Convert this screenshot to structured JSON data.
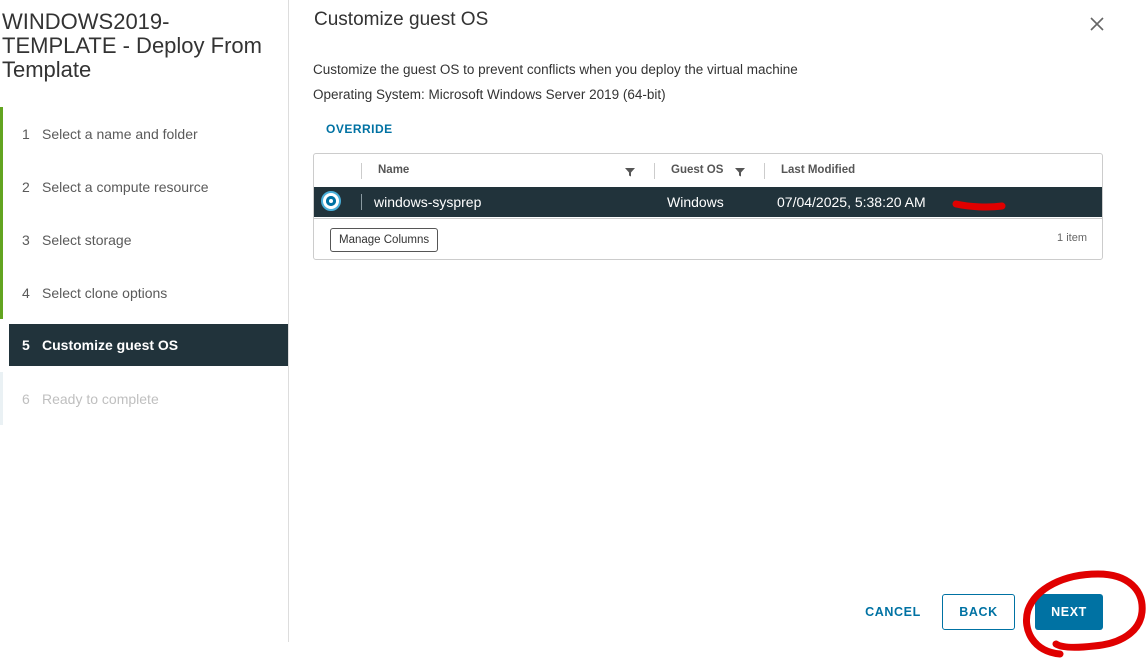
{
  "wizard": {
    "title": "WINDOWS2019-TEMPLATE - Deploy From Template",
    "steps": [
      {
        "num": "1",
        "label": "Select a name and folder"
      },
      {
        "num": "2",
        "label": "Select a compute resource"
      },
      {
        "num": "3",
        "label": "Select storage"
      },
      {
        "num": "4",
        "label": "Select clone options"
      },
      {
        "num": "5",
        "label": "Customize guest OS"
      },
      {
        "num": "6",
        "label": "Ready to complete"
      }
    ]
  },
  "main": {
    "title": "Customize guest OS",
    "description": "Customize the guest OS to prevent conflicts when you deploy the virtual machine",
    "os_line": "Operating System: Microsoft Windows Server 2019 (64-bit)",
    "override_label": "OVERRIDE"
  },
  "grid": {
    "columns": [
      "Name",
      "Guest OS",
      "Last Modified"
    ],
    "rows": [
      {
        "name": "windows-sysprep",
        "guest_os": "Windows",
        "last_modified": "07/04/2025, 5:38:20 AM",
        "selected": true
      }
    ],
    "manage_columns_label": "Manage Columns",
    "item_count": "1 item"
  },
  "footer": {
    "cancel_label": "CANCEL",
    "back_label": "BACK",
    "next_label": "NEXT"
  },
  "colors": {
    "accent": "#0072a3",
    "active_step_bg": "#21333b",
    "completed_step_bar": "#62a420",
    "annotation_red": "#e00000"
  },
  "icons": {
    "close": "close-icon",
    "filter": "filter-icon",
    "radio": "radio-selected-icon"
  }
}
